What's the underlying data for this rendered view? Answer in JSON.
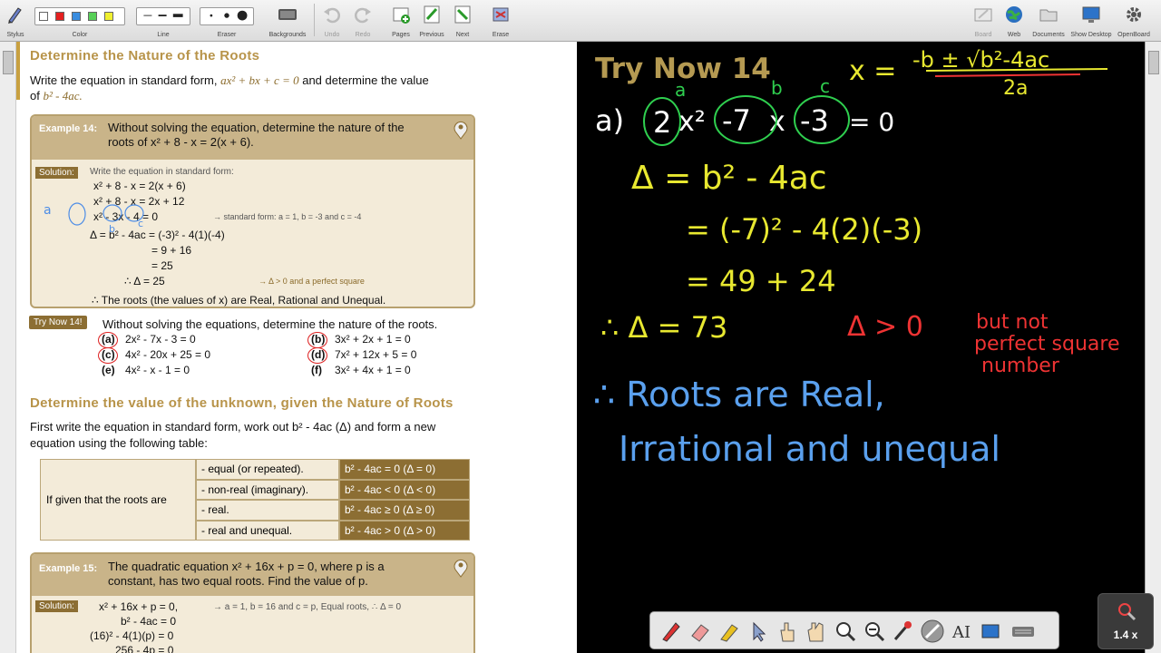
{
  "toolbar": {
    "left": [
      {
        "label": "Stylus"
      },
      {
        "label": "Color"
      },
      {
        "label": "Line"
      },
      {
        "label": "Eraser"
      },
      {
        "label": "Backgrounds"
      },
      {
        "label": "Undo"
      },
      {
        "label": "Redo"
      },
      {
        "label": "Pages"
      },
      {
        "label": "Previous"
      },
      {
        "label": "Next"
      },
      {
        "label": "Erase"
      }
    ],
    "right": [
      {
        "label": "Board"
      },
      {
        "label": "Web"
      },
      {
        "label": "Documents"
      },
      {
        "label": "Show Desktop"
      },
      {
        "label": "OpenBoard"
      }
    ],
    "colors": [
      "#ffffff",
      "#e52020",
      "#3a8de0",
      "#58d058",
      "#f0f030"
    ]
  },
  "doc": {
    "heading1": "Determine the Nature of the Roots",
    "intro1": "Write the equation in standard form,",
    "intro1_math": "ax² + bx + c = 0",
    "intro1_end": "and determine the value",
    "intro2_pre": "of",
    "intro2_math": "b² - 4ac.",
    "ex14": {
      "tag": "Example 14:",
      "q1": "Without solving the equation, determine the nature of the",
      "q2": "roots of  x² + 8 - x = 2(x + 6).",
      "sol_tag": "Solution:",
      "sol_intro": "Write the equation in standard form:",
      "lines": [
        "x² + 8 - x = 2(x + 6)",
        "x² + 8 - x = 2x + 12",
        "x² - 3x - 4 = 0",
        "Δ = b² - 4ac = (-3)² - 4(1)(-4)",
        "= 9 + 16",
        "= 25",
        "∴ Δ  = 25"
      ],
      "note1": "→ standard form: a = 1, b = -3 and c = -4",
      "note2": "→ Δ > 0 and a perfect square",
      "conclusion": "∴ The roots (the values of x) are Real, Rational and Unequal."
    },
    "try_now": {
      "tag": "Try Now 14!",
      "instruction": "Without solving the equations, determine the nature of the roots.",
      "items": [
        {
          "label": "(a)",
          "eq": "2x² - 7x - 3 = 0"
        },
        {
          "label": "(b)",
          "eq": "3x² + 2x + 1 = 0"
        },
        {
          "label": "(c)",
          "eq": "4x² - 20x + 25 = 0"
        },
        {
          "label": "(d)",
          "eq": "7x² + 12x + 5 = 0"
        },
        {
          "label": "(e)",
          "eq": "4x² - x - 1 = 0"
        },
        {
          "label": "(f)",
          "eq": "3x² + 4x + 1 = 0"
        }
      ]
    },
    "heading2": "Determine the value of the unknown, given the Nature of Roots",
    "intro3a": "First write the equation in standard form, work out  b² - 4ac (Δ) and form a new",
    "intro3b": "equation using the following table:",
    "table": {
      "left": "If given that the roots are",
      "rows": [
        {
          "mid": "- equal (or repeated).",
          "rt": "b² - 4ac = 0   (Δ = 0)"
        },
        {
          "mid": "- non-real (imaginary).",
          "rt": "b² - 4ac < 0   (Δ < 0)"
        },
        {
          "mid": "- real.",
          "rt": "b² - 4ac ≥ 0   (Δ ≥ 0)"
        },
        {
          "mid": "- real and unequal.",
          "rt": "b² - 4ac > 0   (Δ > 0)"
        }
      ]
    },
    "ex15": {
      "tag": "Example 15:",
      "q1": "The quadratic equation  x² + 16x + p = 0, where p is a",
      "q2": "constant, has two equal roots.  Find the value of p.",
      "sol_tag": "Solution:",
      "lines": [
        "x² + 16x + p = 0,",
        "b² - 4ac = 0",
        "(16)² - 4(1)(p) = 0",
        "256 - 4p = 0"
      ],
      "note": "→ a = 1, b = 16 and c = p, Equal roots, ∴ Δ = 0"
    }
  },
  "board": {
    "title": "Try Now 14",
    "formula_left": "x =",
    "formula_num": "-b ± √b²-4ac",
    "formula_den": "2a",
    "labels_abc": [
      "a",
      "b",
      "c"
    ],
    "part_a": "a)",
    "eq_parts": [
      "2",
      "x²",
      "-7",
      "x",
      "-3",
      "= 0"
    ],
    "delta1": "Δ = b² - 4ac",
    "delta2": "= (-7)² - 4(2)(-3)",
    "delta3": "= 49 + 24",
    "delta4": "∴ Δ = 73",
    "red_note1": "Δ > 0",
    "red_note2": "but not",
    "red_note3": "perfect square",
    "red_note4": "number",
    "conclusion1": "∴ Roots are Real,",
    "conclusion2": "Irrational and unequal",
    "zoom": "1.4 x"
  }
}
